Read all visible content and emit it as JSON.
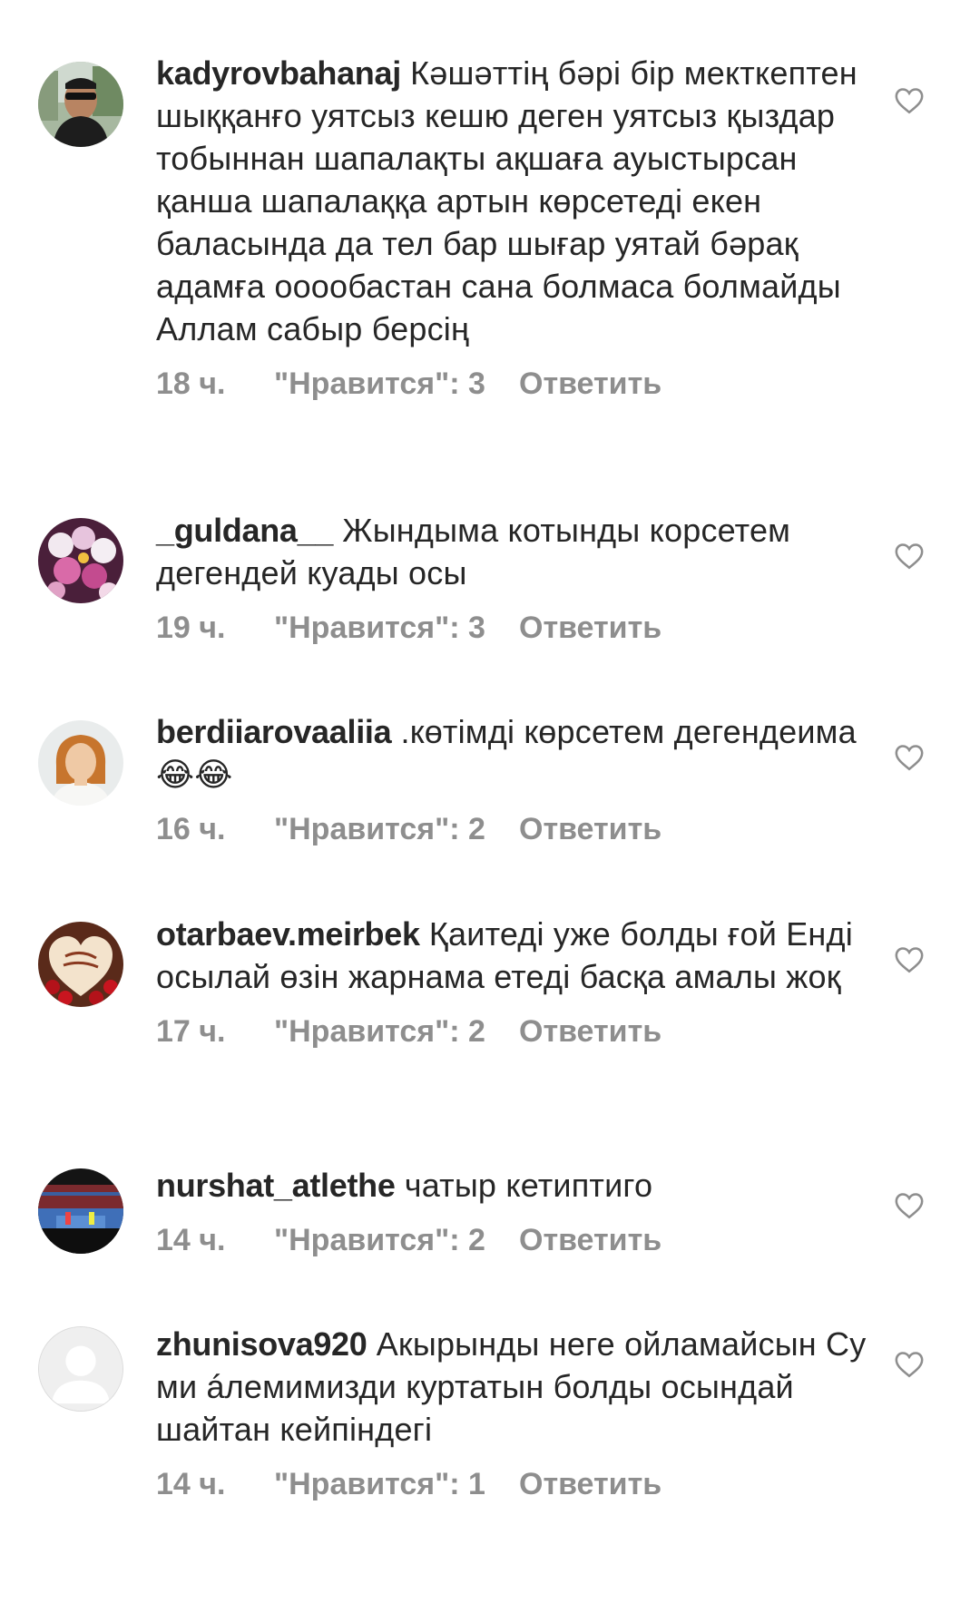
{
  "comments": [
    {
      "username": "kadyrovbahanaj",
      "text": "Кәшәттің бәрі бір мекткептен шыққанғо уятсыз кешю деген уятсыз қыздар тобыннан шапалақты ақшаға ауыстырсан қанша шапалаққа артын көрсетеді екен баласында да тел бар шығар уятай бәрақ адамға оooобастан сана болмаса болмайды Аллам сабыр берсің",
      "time": "18 ч.",
      "likes": "\"Нравится\": 3",
      "reply": "Ответить",
      "avatar_icon": "user-photo-man-sunglasses"
    },
    {
      "username": "_guldana__",
      "text": "Жындыма котынды корсетем дегендей куады осы",
      "time": "19 ч.",
      "likes": "\"Нравится\": 3",
      "reply": "Ответить",
      "avatar_icon": "user-photo-orchids"
    },
    {
      "username": "berdiiarovaaliia",
      "text": ".көтімді көрсетем дегендеима😂😂",
      "time": "16 ч.",
      "likes": "\"Нравится\": 2",
      "reply": "Ответить",
      "avatar_icon": "user-photo-woman"
    },
    {
      "username": "otarbaev.meirbek",
      "text": "Қаитеді уже болды ғой Енді осылай өзін жарнама етеді басқа амалы жоқ",
      "time": "17 ч.",
      "likes": "\"Нравится\": 2",
      "reply": "Ответить",
      "avatar_icon": "user-photo-roses-heart"
    },
    {
      "username": "nurshat_atlethe",
      "text": "чатыр кетиптиго",
      "time": "14 ч.",
      "likes": "\"Нравится\": 2",
      "reply": "Ответить",
      "avatar_icon": "user-photo-arena"
    },
    {
      "username": "zhunisova920",
      "text": "Акырынды неге ойламайсын Су ми áлемимизди куртатын болды осындай шайтан кейпіндегі",
      "time": "14 ч.",
      "likes": "\"Нравится\": 1",
      "reply": "Ответить",
      "avatar_icon": "default-avatar-icon"
    }
  ],
  "colors": {
    "text": "#262626",
    "meta": "#8e8e8e",
    "heart": "#8e8e8e"
  }
}
